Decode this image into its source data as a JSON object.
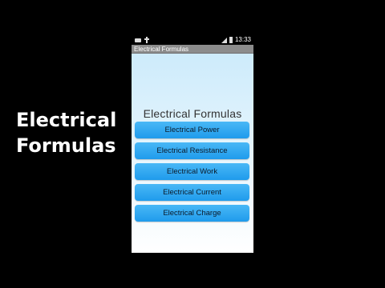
{
  "side_caption": {
    "line1": "Electrical",
    "line2": "Formulas"
  },
  "status_bar": {
    "time": "13:33"
  },
  "app_bar": {
    "title": "Electrical Formulas"
  },
  "main": {
    "heading": "Electrical Formulas",
    "buttons": [
      {
        "label": "Electrical Power"
      },
      {
        "label": "Electrical Resistance"
      },
      {
        "label": "Electrical Work"
      },
      {
        "label": "Electrical Current"
      },
      {
        "label": "Electrical Charge"
      }
    ]
  },
  "colors": {
    "button": "#2aa6f0",
    "background_top": "#cdebfb",
    "status_bar": "#000000",
    "app_bar": "#8c8c8c"
  }
}
